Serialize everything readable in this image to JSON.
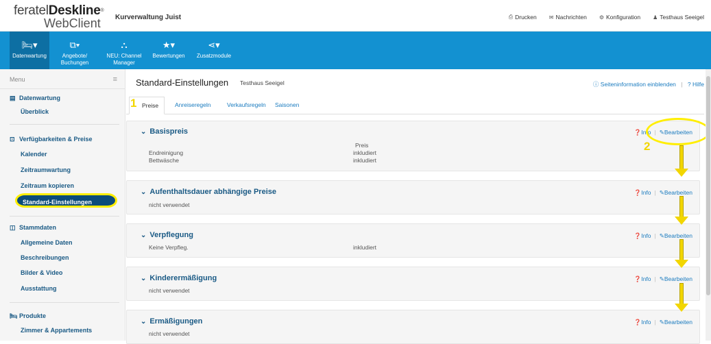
{
  "header": {
    "logo_line1_a": "feratel",
    "logo_line1_b": "Deskline",
    "logo_reg": "®",
    "logo_line2": "WebClient",
    "org_title": "Kurverwaltung Juist",
    "links": [
      {
        "icon": "print-icon",
        "label": "Drucken"
      },
      {
        "icon": "envelope-icon",
        "label": "Nachrichten"
      },
      {
        "icon": "gear-icon",
        "label": "Konfiguration"
      },
      {
        "icon": "user-icon",
        "label": "Testhaus Seeigel"
      }
    ]
  },
  "nav": [
    {
      "icon": "bed-icon",
      "label1": "Datenwartung",
      "label2": "",
      "active": true
    },
    {
      "icon": "bookings-icon",
      "label1": "Angebote/",
      "label2": "Buchungen",
      "active": false
    },
    {
      "icon": "sitemap-icon",
      "label1": "NEU: Channel",
      "label2": "Manager",
      "active": false
    },
    {
      "icon": "star-icon",
      "label1": "Bewertungen",
      "label2": "",
      "active": false
    },
    {
      "icon": "share-icon",
      "label1": "Zusatzmodule",
      "label2": "",
      "active": false
    }
  ],
  "sidebar": {
    "menu_label": "Menu",
    "sections": [
      {
        "title": "Datenwartung",
        "items": [
          "Überblick"
        ]
      },
      {
        "title": "Verfügbarkeiten & Preise",
        "items": [
          "Kalender",
          "Zeitraumwartung",
          "Zeitraum kopieren",
          "Standard-Einstellungen"
        ]
      },
      {
        "title": "Stammdaten",
        "items": [
          "Allgemeine Daten",
          "Beschreibungen",
          "Bilder & Video",
          "Ausstattung"
        ]
      },
      {
        "title": "Produkte",
        "items": [
          "Zimmer & Appartements"
        ]
      }
    ],
    "active_item": "Standard-Einstellungen"
  },
  "main": {
    "title": "Standard-Einstellungen",
    "subtitle": "Testhaus Seeigel",
    "link_info": "Seiteninformation einblenden",
    "link_help": "Hilfe",
    "tabs": [
      "Preise",
      "Anreiseregeln",
      "Verkaufsregeln",
      "Saisonen"
    ],
    "active_tab": "Preise",
    "step1": "1",
    "step2": "2",
    "info_label": "Info",
    "edit_label": "Bearbeiten",
    "panels": [
      {
        "title": "Basispreis",
        "col_header": "Preis",
        "rows": [
          [
            "Endreinigung",
            "inkludiert"
          ],
          [
            "Bettwäsche",
            "inkludiert"
          ]
        ]
      },
      {
        "title": "Aufenthaltsdauer abhängige Preise",
        "rows": [
          [
            "nicht verwendet",
            ""
          ]
        ]
      },
      {
        "title": "Verpflegung",
        "rows": [
          [
            "Keine Verpfleg.",
            "inkludiert"
          ]
        ]
      },
      {
        "title": "Kinderermäßigung",
        "rows": [
          [
            "nicht verwendet",
            ""
          ]
        ]
      },
      {
        "title": "Ermäßigungen",
        "rows": [
          [
            "nicht verwendet",
            ""
          ]
        ]
      }
    ]
  },
  "colors": {
    "nav_blue": "#1391d1",
    "nav_active": "#0d6fa3",
    "link_blue": "#1a7bbf",
    "highlight_yellow": "#ffee00"
  }
}
